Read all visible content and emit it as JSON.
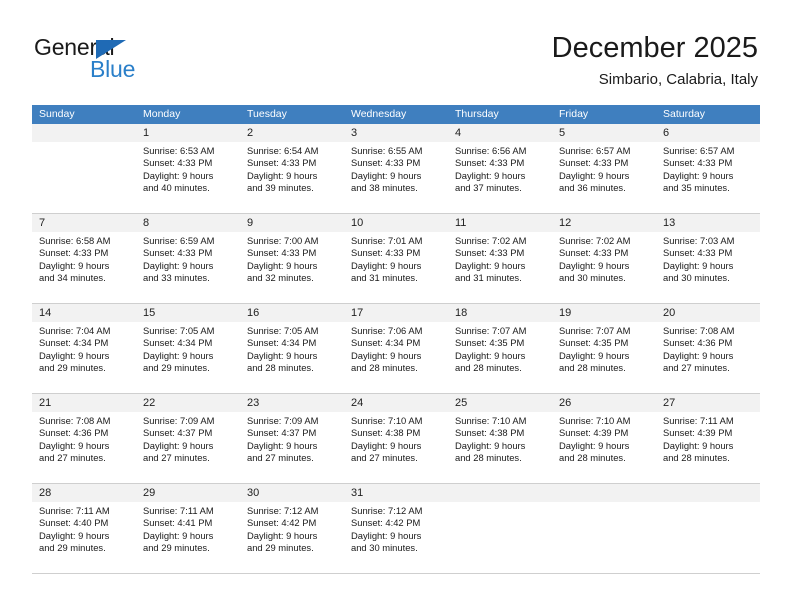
{
  "brand": {
    "name_part1": "General",
    "name_part2": "Blue",
    "accent_color": "#2a7fc9",
    "triangle_color": "#1f6ab5"
  },
  "header": {
    "title": "December 2025",
    "subtitle": "Simbario, Calabria, Italy"
  },
  "calendar": {
    "header_bg": "#3f7fbf",
    "weekdays": [
      "Sunday",
      "Monday",
      "Tuesday",
      "Wednesday",
      "Thursday",
      "Friday",
      "Saturday"
    ],
    "weeks": [
      [
        {
          "day": "",
          "sunrise": "",
          "sunset": "",
          "daylight_line1": "",
          "daylight_line2": ""
        },
        {
          "day": "1",
          "sunrise": "Sunrise: 6:53 AM",
          "sunset": "Sunset: 4:33 PM",
          "daylight_line1": "Daylight: 9 hours",
          "daylight_line2": "and 40 minutes."
        },
        {
          "day": "2",
          "sunrise": "Sunrise: 6:54 AM",
          "sunset": "Sunset: 4:33 PM",
          "daylight_line1": "Daylight: 9 hours",
          "daylight_line2": "and 39 minutes."
        },
        {
          "day": "3",
          "sunrise": "Sunrise: 6:55 AM",
          "sunset": "Sunset: 4:33 PM",
          "daylight_line1": "Daylight: 9 hours",
          "daylight_line2": "and 38 minutes."
        },
        {
          "day": "4",
          "sunrise": "Sunrise: 6:56 AM",
          "sunset": "Sunset: 4:33 PM",
          "daylight_line1": "Daylight: 9 hours",
          "daylight_line2": "and 37 minutes."
        },
        {
          "day": "5",
          "sunrise": "Sunrise: 6:57 AM",
          "sunset": "Sunset: 4:33 PM",
          "daylight_line1": "Daylight: 9 hours",
          "daylight_line2": "and 36 minutes."
        },
        {
          "day": "6",
          "sunrise": "Sunrise: 6:57 AM",
          "sunset": "Sunset: 4:33 PM",
          "daylight_line1": "Daylight: 9 hours",
          "daylight_line2": "and 35 minutes."
        }
      ],
      [
        {
          "day": "7",
          "sunrise": "Sunrise: 6:58 AM",
          "sunset": "Sunset: 4:33 PM",
          "daylight_line1": "Daylight: 9 hours",
          "daylight_line2": "and 34 minutes."
        },
        {
          "day": "8",
          "sunrise": "Sunrise: 6:59 AM",
          "sunset": "Sunset: 4:33 PM",
          "daylight_line1": "Daylight: 9 hours",
          "daylight_line2": "and 33 minutes."
        },
        {
          "day": "9",
          "sunrise": "Sunrise: 7:00 AM",
          "sunset": "Sunset: 4:33 PM",
          "daylight_line1": "Daylight: 9 hours",
          "daylight_line2": "and 32 minutes."
        },
        {
          "day": "10",
          "sunrise": "Sunrise: 7:01 AM",
          "sunset": "Sunset: 4:33 PM",
          "daylight_line1": "Daylight: 9 hours",
          "daylight_line2": "and 31 minutes."
        },
        {
          "day": "11",
          "sunrise": "Sunrise: 7:02 AM",
          "sunset": "Sunset: 4:33 PM",
          "daylight_line1": "Daylight: 9 hours",
          "daylight_line2": "and 31 minutes."
        },
        {
          "day": "12",
          "sunrise": "Sunrise: 7:02 AM",
          "sunset": "Sunset: 4:33 PM",
          "daylight_line1": "Daylight: 9 hours",
          "daylight_line2": "and 30 minutes."
        },
        {
          "day": "13",
          "sunrise": "Sunrise: 7:03 AM",
          "sunset": "Sunset: 4:33 PM",
          "daylight_line1": "Daylight: 9 hours",
          "daylight_line2": "and 30 minutes."
        }
      ],
      [
        {
          "day": "14",
          "sunrise": "Sunrise: 7:04 AM",
          "sunset": "Sunset: 4:34 PM",
          "daylight_line1": "Daylight: 9 hours",
          "daylight_line2": "and 29 minutes."
        },
        {
          "day": "15",
          "sunrise": "Sunrise: 7:05 AM",
          "sunset": "Sunset: 4:34 PM",
          "daylight_line1": "Daylight: 9 hours",
          "daylight_line2": "and 29 minutes."
        },
        {
          "day": "16",
          "sunrise": "Sunrise: 7:05 AM",
          "sunset": "Sunset: 4:34 PM",
          "daylight_line1": "Daylight: 9 hours",
          "daylight_line2": "and 28 minutes."
        },
        {
          "day": "17",
          "sunrise": "Sunrise: 7:06 AM",
          "sunset": "Sunset: 4:34 PM",
          "daylight_line1": "Daylight: 9 hours",
          "daylight_line2": "and 28 minutes."
        },
        {
          "day": "18",
          "sunrise": "Sunrise: 7:07 AM",
          "sunset": "Sunset: 4:35 PM",
          "daylight_line1": "Daylight: 9 hours",
          "daylight_line2": "and 28 minutes."
        },
        {
          "day": "19",
          "sunrise": "Sunrise: 7:07 AM",
          "sunset": "Sunset: 4:35 PM",
          "daylight_line1": "Daylight: 9 hours",
          "daylight_line2": "and 28 minutes."
        },
        {
          "day": "20",
          "sunrise": "Sunrise: 7:08 AM",
          "sunset": "Sunset: 4:36 PM",
          "daylight_line1": "Daylight: 9 hours",
          "daylight_line2": "and 27 minutes."
        }
      ],
      [
        {
          "day": "21",
          "sunrise": "Sunrise: 7:08 AM",
          "sunset": "Sunset: 4:36 PM",
          "daylight_line1": "Daylight: 9 hours",
          "daylight_line2": "and 27 minutes."
        },
        {
          "day": "22",
          "sunrise": "Sunrise: 7:09 AM",
          "sunset": "Sunset: 4:37 PM",
          "daylight_line1": "Daylight: 9 hours",
          "daylight_line2": "and 27 minutes."
        },
        {
          "day": "23",
          "sunrise": "Sunrise: 7:09 AM",
          "sunset": "Sunset: 4:37 PM",
          "daylight_line1": "Daylight: 9 hours",
          "daylight_line2": "and 27 minutes."
        },
        {
          "day": "24",
          "sunrise": "Sunrise: 7:10 AM",
          "sunset": "Sunset: 4:38 PM",
          "daylight_line1": "Daylight: 9 hours",
          "daylight_line2": "and 27 minutes."
        },
        {
          "day": "25",
          "sunrise": "Sunrise: 7:10 AM",
          "sunset": "Sunset: 4:38 PM",
          "daylight_line1": "Daylight: 9 hours",
          "daylight_line2": "and 28 minutes."
        },
        {
          "day": "26",
          "sunrise": "Sunrise: 7:10 AM",
          "sunset": "Sunset: 4:39 PM",
          "daylight_line1": "Daylight: 9 hours",
          "daylight_line2": "and 28 minutes."
        },
        {
          "day": "27",
          "sunrise": "Sunrise: 7:11 AM",
          "sunset": "Sunset: 4:39 PM",
          "daylight_line1": "Daylight: 9 hours",
          "daylight_line2": "and 28 minutes."
        }
      ],
      [
        {
          "day": "28",
          "sunrise": "Sunrise: 7:11 AM",
          "sunset": "Sunset: 4:40 PM",
          "daylight_line1": "Daylight: 9 hours",
          "daylight_line2": "and 29 minutes."
        },
        {
          "day": "29",
          "sunrise": "Sunrise: 7:11 AM",
          "sunset": "Sunset: 4:41 PM",
          "daylight_line1": "Daylight: 9 hours",
          "daylight_line2": "and 29 minutes."
        },
        {
          "day": "30",
          "sunrise": "Sunrise: 7:12 AM",
          "sunset": "Sunset: 4:42 PM",
          "daylight_line1": "Daylight: 9 hours",
          "daylight_line2": "and 29 minutes."
        },
        {
          "day": "31",
          "sunrise": "Sunrise: 7:12 AM",
          "sunset": "Sunset: 4:42 PM",
          "daylight_line1": "Daylight: 9 hours",
          "daylight_line2": "and 30 minutes."
        },
        {
          "day": "",
          "sunrise": "",
          "sunset": "",
          "daylight_line1": "",
          "daylight_line2": ""
        },
        {
          "day": "",
          "sunrise": "",
          "sunset": "",
          "daylight_line1": "",
          "daylight_line2": ""
        },
        {
          "day": "",
          "sunrise": "",
          "sunset": "",
          "daylight_line1": "",
          "daylight_line2": ""
        }
      ]
    ]
  }
}
